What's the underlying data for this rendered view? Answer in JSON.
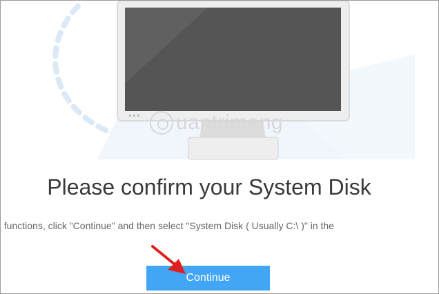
{
  "watermark": {
    "text": "uantrimang",
    "icon": "lightbulb-icon"
  },
  "headline": "Please confirm your System Disk",
  "instruction": "al functions, click \"Continue\" and then select \"System Disk ( Usually C:\\ )\" in the",
  "continue_button": {
    "label": "Continue"
  },
  "colors": {
    "accent": "#42a5f5",
    "pointer_arrow": "#e02020",
    "screen": "#555555",
    "monitor_body": "#eeeeee"
  },
  "icons": {
    "pointer": "red-arrow-icon"
  }
}
